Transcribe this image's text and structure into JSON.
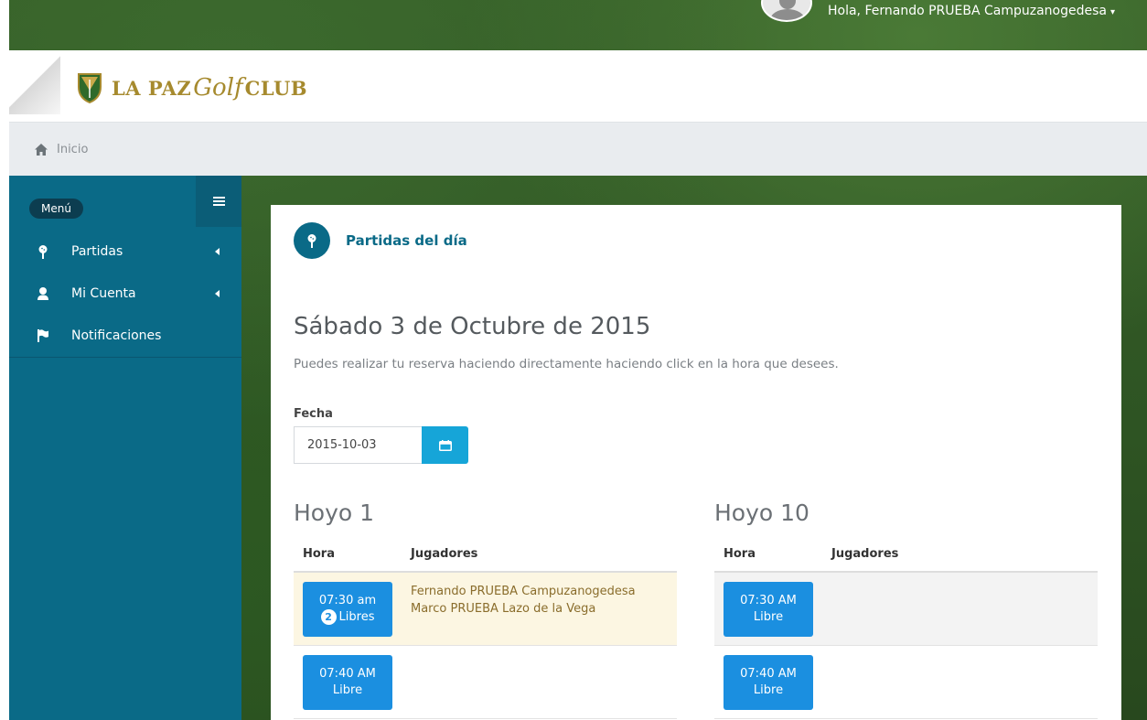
{
  "user": {
    "greeting": "Hola, Fernando PRUEBA Campuzanogedesa",
    "caret": "▾"
  },
  "brand": {
    "logo_part1": "LA PAZ",
    "logo_script": "Golf",
    "logo_part2": "CLUB",
    "color": "#a68a2e"
  },
  "breadcrumb": {
    "home": "Inicio"
  },
  "sidebar": {
    "menu_label": "Menú",
    "items": [
      {
        "label": "Partidas",
        "icon": "golf-pin-icon",
        "has_submenu": true
      },
      {
        "label": "Mi Cuenta",
        "icon": "user-icon",
        "has_submenu": true
      },
      {
        "label": "Notificaciones",
        "icon": "flag-icon",
        "has_submenu": false
      }
    ],
    "color": "#0a6a87"
  },
  "panel": {
    "title": "Partidas del día",
    "date_heading": "Sábado 3 de Octubre de 2015",
    "hint": "Puedes realizar tu reserva haciendo directamente haciendo click en la hora que desees.",
    "fecha_label": "Fecha",
    "fecha_value": "2015-10-03"
  },
  "hoyos": [
    {
      "title": "Hoyo 1",
      "col_hora": "Hora",
      "col_jugadores": "Jugadores",
      "rows": [
        {
          "time": "07:30 am",
          "badge": "2",
          "status": "Libres",
          "players": [
            "Fernando PRUEBA Campuzanogedesa",
            "Marco PRUEBA Lazo de la Vega"
          ]
        },
        {
          "time": "07:40 AM",
          "status": "Libre",
          "players": []
        }
      ]
    },
    {
      "title": "Hoyo 10",
      "col_hora": "Hora",
      "col_jugadores": "Jugadores",
      "rows": [
        {
          "time": "07:30 AM",
          "status": "Libre",
          "players": []
        },
        {
          "time": "07:40 AM",
          "status": "Libre",
          "players": []
        }
      ]
    }
  ],
  "colors": {
    "slot_button": "#1b8fe0",
    "reserved_row": "#fcf6e2",
    "datepicker_button": "#16a5d8"
  }
}
